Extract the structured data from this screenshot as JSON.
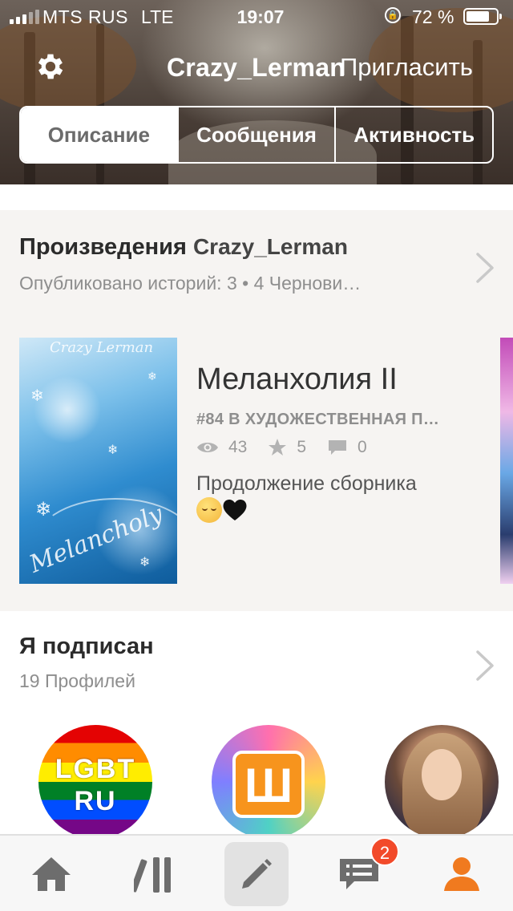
{
  "status_bar": {
    "carrier": "MTS RUS",
    "network": "LTE",
    "time": "19:07",
    "battery_percent": "72 %"
  },
  "header": {
    "profile_name": "Crazy_Lerman",
    "invite_label": "Пригласить",
    "tabs": [
      {
        "label": "Описание",
        "selected": true
      },
      {
        "label": "Сообщения",
        "selected": false
      },
      {
        "label": "Активность",
        "selected": false
      }
    ]
  },
  "works": {
    "title": "Произведения",
    "title_user": "Crazy_Lerman",
    "subtitle": "Опубликовано историй: 3 • 4 Чернови…",
    "book": {
      "cover_author": "Crazy Lerman",
      "cover_title": "Melancholy",
      "title": "Меланхолия II",
      "rank": "#84 В ХУДОЖЕСТВЕННАЯ П…",
      "views": "43",
      "votes": "5",
      "comments": "0",
      "description": "Продолжение сборника"
    }
  },
  "following": {
    "title": "Я подписан",
    "subtitle": "19 Профилей",
    "avatars": [
      {
        "line1": "LGBT",
        "line2": "RU"
      },
      {
        "letter": "Ш"
      },
      {
        "name": ""
      }
    ]
  },
  "tabbar": {
    "items": [
      "home-icon",
      "library-icon",
      "write-icon",
      "messages-icon",
      "profile-icon"
    ],
    "messages_badge": "2",
    "active_color": "#f07a1f",
    "inactive_color": "#6d6d6d"
  }
}
